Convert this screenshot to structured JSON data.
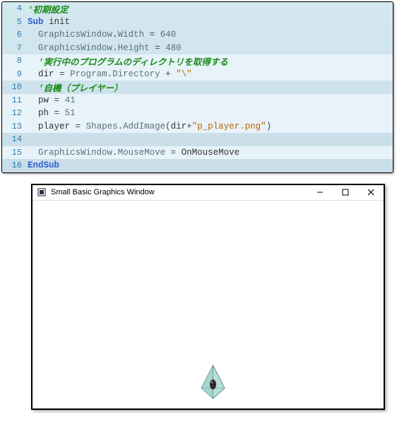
{
  "code": {
    "lines": [
      {
        "no": 4,
        "hl": false,
        "tokens": [
          [
            "comment",
            "'初期設定"
          ]
        ]
      },
      {
        "no": 5,
        "hl": false,
        "tokens": [
          [
            "keyword",
            "Sub "
          ],
          [
            "txt",
            "init"
          ]
        ]
      },
      {
        "no": 6,
        "hl": false,
        "indent": "  ",
        "tokens": [
          [
            "type",
            "GraphicsWindow"
          ],
          [
            "op",
            "."
          ],
          [
            "member",
            "Width"
          ],
          [
            "txt",
            " "
          ],
          [
            "op",
            "="
          ],
          [
            "txt",
            " "
          ],
          [
            "num",
            "640"
          ]
        ]
      },
      {
        "no": 7,
        "hl": false,
        "indent": "  ",
        "tokens": [
          [
            "type",
            "GraphicsWindow"
          ],
          [
            "op",
            "."
          ],
          [
            "member",
            "Height"
          ],
          [
            "txt",
            " "
          ],
          [
            "op",
            "="
          ],
          [
            "txt",
            " "
          ],
          [
            "num",
            "480"
          ]
        ]
      },
      {
        "no": 8,
        "hl": true,
        "indent": "  ",
        "tokens": [
          [
            "comment",
            "'実行中のプログラムのディレクトリを取得する"
          ]
        ]
      },
      {
        "no": 9,
        "hl": true,
        "indent": "  ",
        "tokens": [
          [
            "txt",
            "dir "
          ],
          [
            "op",
            "="
          ],
          [
            "txt",
            " "
          ],
          [
            "type",
            "Program"
          ],
          [
            "op",
            "."
          ],
          [
            "member",
            "Directory"
          ],
          [
            "txt",
            " "
          ],
          [
            "op",
            "+"
          ],
          [
            "txt",
            " "
          ],
          [
            "str",
            "\"\\\""
          ]
        ]
      },
      {
        "no": 10,
        "hl": false,
        "indent": "  ",
        "tokens": [
          [
            "comment",
            "'自機（プレイヤー）"
          ]
        ]
      },
      {
        "no": 11,
        "hl": true,
        "indent": "  ",
        "tokens": [
          [
            "txt",
            "pw "
          ],
          [
            "op",
            "="
          ],
          [
            "txt",
            " "
          ],
          [
            "num",
            "41"
          ]
        ]
      },
      {
        "no": 12,
        "hl": true,
        "indent": "  ",
        "tokens": [
          [
            "txt",
            "ph "
          ],
          [
            "op",
            "="
          ],
          [
            "txt",
            " "
          ],
          [
            "num",
            "51"
          ]
        ]
      },
      {
        "no": 13,
        "hl": true,
        "indent": "  ",
        "tokens": [
          [
            "txt",
            "player "
          ],
          [
            "op",
            "="
          ],
          [
            "txt",
            " "
          ],
          [
            "type",
            "Shapes"
          ],
          [
            "op",
            "."
          ],
          [
            "member",
            "AddImage"
          ],
          [
            "op",
            "("
          ],
          [
            "txt",
            "dir"
          ],
          [
            "op",
            "+"
          ],
          [
            "str",
            "\"p_player.png\""
          ],
          [
            "op",
            ")"
          ]
        ]
      },
      {
        "no": 14,
        "hl": false,
        "tokens": []
      },
      {
        "no": 15,
        "hl": true,
        "indent": "  ",
        "tokens": [
          [
            "type",
            "GraphicsWindow"
          ],
          [
            "op",
            "."
          ],
          [
            "member",
            "MouseMove"
          ],
          [
            "txt",
            " "
          ],
          [
            "op",
            "="
          ],
          [
            "txt",
            " "
          ],
          [
            "txt",
            "OnMouseMove"
          ]
        ]
      },
      {
        "no": 16,
        "hl": false,
        "tokens": [
          [
            "keyword",
            "EndSub"
          ]
        ]
      }
    ]
  },
  "window": {
    "title": "Small Basic Graphics Window",
    "minimize_tip": "Minimize",
    "maximize_tip": "Maximize",
    "close_tip": "Close"
  }
}
